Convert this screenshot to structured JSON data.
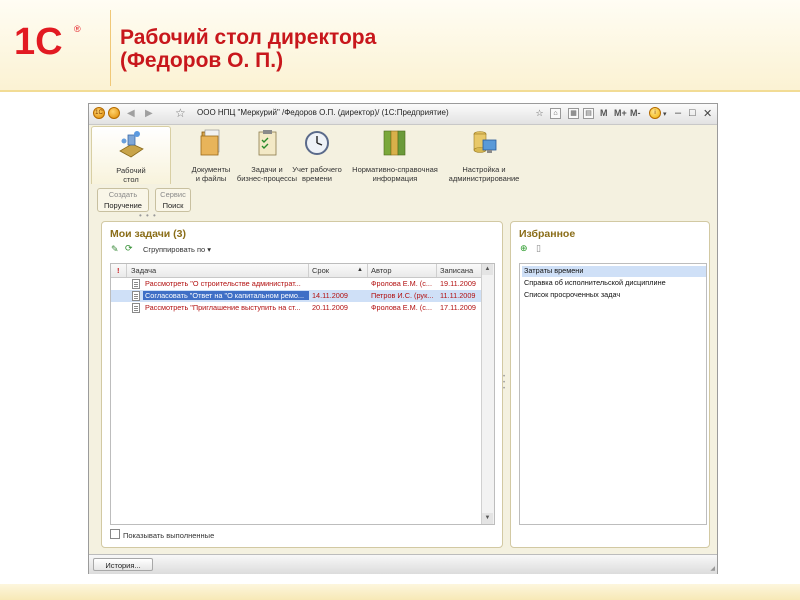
{
  "slide": {
    "title": "Рабочий стол директора\n(Федоров О. П.)",
    "logo_text": "1С",
    "logo_mark": "®"
  },
  "window": {
    "title": "ООО НПЦ \"Меркурий\" /Федоров О.П. (директор)/  (1С:Предприятие)",
    "app_badge": "1С",
    "nav_back": "◀",
    "nav_forward": "▶",
    "menu_m1": "M",
    "menu_m2": "M+",
    "menu_m3": "M-",
    "info": "i",
    "minimize": "–",
    "maximize": "□",
    "close": "✕"
  },
  "sections": [
    {
      "label": "Рабочий\nстол",
      "icon": "desktop-icon"
    },
    {
      "label": "Документы\nи файлы",
      "icon": "documents-icon"
    },
    {
      "label": "Задачи и\nбизнес-процессы",
      "icon": "tasks-icon"
    },
    {
      "label": "Учет рабочего\nвремени",
      "icon": "clock-icon"
    },
    {
      "label": "Нормативно-справочная\nинформация",
      "icon": "binders-icon"
    },
    {
      "label": "Настройка и\nадминистрирование",
      "icon": "admin-icon"
    }
  ],
  "actions": {
    "create": {
      "title": "Создать",
      "item": "Поручение"
    },
    "service": {
      "title": "Сервис",
      "item": "Поиск"
    }
  },
  "tasks_panel": {
    "title": "Мои задачи (3)",
    "group_by": "Сгруппировать по ▾",
    "columns": {
      "flag": "!",
      "task": "Задача",
      "due": "Срок",
      "author": "Автор",
      "recorded": "Записана"
    },
    "rows": [
      {
        "task": "Рассмотреть \"О строительстве администрат...",
        "due": "",
        "author": "Фролова Е.М. (с...",
        "recorded": "19.11.2009",
        "selected": false
      },
      {
        "task": "Согласовать \"Ответ на \"О капитальном ремо...",
        "due": "14.11.2009",
        "author": "Петров И.С. (рук...",
        "recorded": "11.11.2009",
        "selected": true
      },
      {
        "task": "Рассмотреть \"Приглашение выступить на ст...",
        "due": "20.11.2009",
        "author": "Фролова Е.М. (с...",
        "recorded": "17.11.2009",
        "selected": false
      }
    ],
    "show_completed": "Показывать выполненные"
  },
  "favorites_panel": {
    "title": "Избранное",
    "items": [
      {
        "label": "Затраты времени",
        "selected": true
      },
      {
        "label": "Справка об исполнительской дисциплине",
        "selected": false
      },
      {
        "label": "Список просроченных задач",
        "selected": false
      }
    ]
  },
  "bottom": {
    "history": "История..."
  },
  "colors": {
    "accent_red": "#c8171c",
    "panel_title": "#8a6d18",
    "selection": "#cfe0f7"
  }
}
